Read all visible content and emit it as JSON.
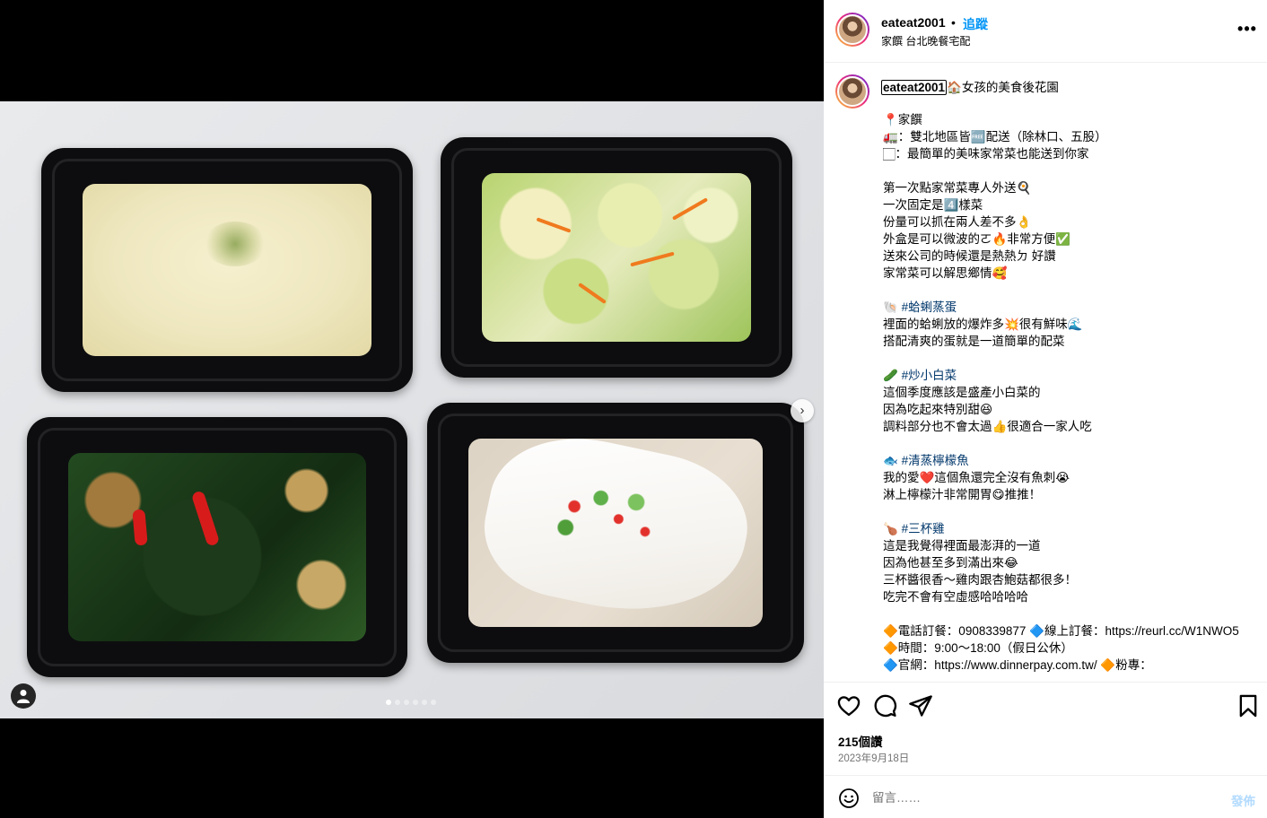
{
  "post": {
    "username": "eateat2001",
    "separator": "•",
    "follow_label": "追蹤",
    "subtitle": "家饌 台北晚餐宅配",
    "more_label": "•••"
  },
  "media": {
    "next_label": "›",
    "carousel": {
      "count": 6,
      "active_index": 0
    },
    "dishes": [
      "steamed-egg-clams",
      "stir-fried-bok-choy",
      "three-cup-chicken",
      "steamed-lemon-fish"
    ]
  },
  "caption": {
    "username": "eateat2001",
    "headline": "🏠女孩的美食後花園",
    "lines": [
      {
        "t": "📍家饌"
      },
      {
        "t": "🚛：雙北地區皆🆓配送（除林口、五股）"
      },
      {
        "t": "🏻：最簡單的美味家常菜也能送到你家"
      },
      {
        "gap": true
      },
      {
        "t": "第一次點家常菜專人外送🍳"
      },
      {
        "t": "一次固定是4️⃣樣菜"
      },
      {
        "t": "份量可以抓在兩人差不多👌"
      },
      {
        "t": "外盒是可以微波的ㄛ🔥非常方便✅"
      },
      {
        "t": "送來公司的時候還是熱熱ㄉ 好讚"
      },
      {
        "t": "家常菜可以解思鄉情🥰"
      },
      {
        "gap": true
      },
      {
        "icon": "🐚",
        "tag": "#蛤蜊蒸蛋"
      },
      {
        "t": "裡面的蛤蜊放的爆炸多💥很有鮮味🌊"
      },
      {
        "t": "搭配清爽的蛋就是一道簡單的配菜"
      },
      {
        "gap": true
      },
      {
        "icon": "🥒",
        "tag": "#炒小白菜"
      },
      {
        "t": "這個季度應該是盛產小白菜的"
      },
      {
        "t": "因為吃起來特別甜😆"
      },
      {
        "t": "調料部分也不會太過👍很適合一家人吃"
      },
      {
        "gap": true
      },
      {
        "icon": "🐟",
        "tag": "#清蒸檸檬魚"
      },
      {
        "t": "我的愛❤️這個魚還完全沒有魚刺😭"
      },
      {
        "t": "淋上檸檬汁非常開胃😋推推！"
      },
      {
        "gap": true
      },
      {
        "icon": "🍗",
        "tag": "#三杯雞"
      },
      {
        "t": "這是我覺得裡面最澎湃的一道"
      },
      {
        "t": "因為他甚至多到滿出來😂"
      },
      {
        "t": "三杯醬很香～雞肉跟杏鮑菇都很多！"
      },
      {
        "t": "吃完不會有空虛感哈哈哈哈"
      },
      {
        "gap": true
      },
      {
        "t": "🔶電話訂餐：0908339877 🔷線上訂餐：https://reurl.cc/W1NWO5"
      },
      {
        "t": "🔶時間：9:00～18:00（假日公休）"
      },
      {
        "t": "🔷官網：https://www.dinnerpay.com.tw/ 🔶粉專："
      }
    ]
  },
  "actions": {
    "likes": "215個讚",
    "date": "2023年9月18日"
  },
  "comment": {
    "placeholder": "留言……",
    "post_label": "發佈"
  },
  "colors": {
    "accent": "#0095f6",
    "hashtag": "#00376b",
    "muted": "#737373",
    "post_disabled": "#b3dbff"
  }
}
